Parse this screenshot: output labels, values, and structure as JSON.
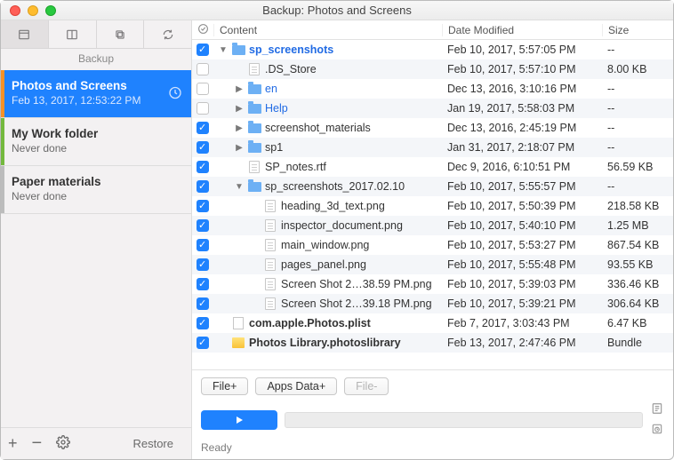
{
  "window": {
    "title": "Backup: Photos and Screens"
  },
  "sidebar": {
    "label": "Backup",
    "plans": [
      {
        "name": "Photos and Screens",
        "sub": "Feb 13, 2017, 12:53:22 PM",
        "accent": "#f59127",
        "selected": true,
        "clock": true
      },
      {
        "name": "My Work folder",
        "sub": "Never done",
        "accent": "#74b93e",
        "selected": false,
        "clock": false
      },
      {
        "name": "Paper materials",
        "sub": "Never done",
        "accent": "#bcbcbc",
        "selected": false,
        "clock": false
      }
    ],
    "footer": {
      "restore": "Restore"
    }
  },
  "columns": {
    "content": "Content",
    "date": "Date Modified",
    "size": "Size"
  },
  "rows": [
    {
      "checked": true,
      "indent": 0,
      "disc": "down",
      "icon": "folder",
      "name": "sp_screenshots",
      "cls": "blue bold",
      "date": "Feb 10, 2017, 5:57:05 PM",
      "size": "--"
    },
    {
      "checked": false,
      "indent": 1,
      "disc": "",
      "icon": "file",
      "name": ".DS_Store",
      "cls": "",
      "date": "Feb 10, 2017, 5:57:10 PM",
      "size": "8.00 KB"
    },
    {
      "checked": false,
      "indent": 1,
      "disc": "right",
      "icon": "folder",
      "name": "en",
      "cls": "blue",
      "date": "Dec 13, 2016, 3:10:16 PM",
      "size": "--"
    },
    {
      "checked": false,
      "indent": 1,
      "disc": "right",
      "icon": "folder",
      "name": "Help",
      "cls": "blue",
      "date": "Jan 19, 2017, 5:58:03 PM",
      "size": "--"
    },
    {
      "checked": true,
      "indent": 1,
      "disc": "right",
      "icon": "folder",
      "name": "screenshot_materials",
      "cls": "",
      "date": "Dec 13, 2016, 2:45:19 PM",
      "size": "--"
    },
    {
      "checked": true,
      "indent": 1,
      "disc": "right",
      "icon": "folder",
      "name": "sp1",
      "cls": "",
      "date": "Jan 31, 2017, 2:18:07 PM",
      "size": "--"
    },
    {
      "checked": true,
      "indent": 1,
      "disc": "",
      "icon": "file",
      "name": "SP_notes.rtf",
      "cls": "",
      "date": "Dec 9, 2016, 6:10:51 PM",
      "size": "56.59 KB"
    },
    {
      "checked": true,
      "indent": 1,
      "disc": "down",
      "icon": "folder",
      "name": "sp_screenshots_2017.02.10",
      "cls": "",
      "date": "Feb 10, 2017, 5:55:57 PM",
      "size": "--"
    },
    {
      "checked": true,
      "indent": 2,
      "disc": "",
      "icon": "file",
      "name": "heading_3d_text.png",
      "cls": "",
      "date": "Feb 10, 2017, 5:50:39 PM",
      "size": "218.58 KB"
    },
    {
      "checked": true,
      "indent": 2,
      "disc": "",
      "icon": "file",
      "name": "inspector_document.png",
      "cls": "",
      "date": "Feb 10, 2017, 5:40:10 PM",
      "size": "1.25 MB"
    },
    {
      "checked": true,
      "indent": 2,
      "disc": "",
      "icon": "file",
      "name": "main_window.png",
      "cls": "",
      "date": "Feb 10, 2017, 5:53:27 PM",
      "size": "867.54 KB"
    },
    {
      "checked": true,
      "indent": 2,
      "disc": "",
      "icon": "file",
      "name": "pages_panel.png",
      "cls": "",
      "date": "Feb 10, 2017, 5:55:48 PM",
      "size": "93.55 KB"
    },
    {
      "checked": true,
      "indent": 2,
      "disc": "",
      "icon": "file",
      "name": "Screen Shot 2…38.59 PM.png",
      "cls": "",
      "date": "Feb 10, 2017, 5:39:03 PM",
      "size": "336.46 KB"
    },
    {
      "checked": true,
      "indent": 2,
      "disc": "",
      "icon": "file",
      "name": "Screen Shot 2…39.18 PM.png",
      "cls": "",
      "date": "Feb 10, 2017, 5:39:21 PM",
      "size": "306.64 KB"
    },
    {
      "checked": true,
      "indent": 0,
      "disc": "",
      "icon": "plist",
      "name": "com.apple.Photos.plist",
      "cls": "bold",
      "date": "Feb 7, 2017, 3:03:43 PM",
      "size": "6.47 KB"
    },
    {
      "checked": true,
      "indent": 0,
      "disc": "",
      "icon": "lib",
      "name": "Photos Library.photoslibrary",
      "cls": "bold",
      "date": "Feb 13, 2017, 2:47:46 PM",
      "size": "Bundle"
    }
  ],
  "bottom": {
    "buttons": {
      "fileplus": "File+",
      "appsdata": "Apps Data+",
      "fileminus": "File-"
    },
    "status": "Ready"
  }
}
